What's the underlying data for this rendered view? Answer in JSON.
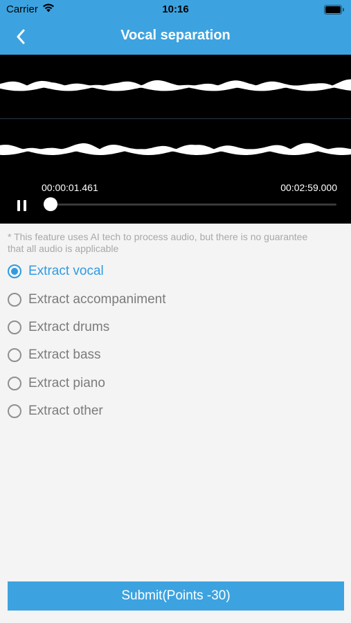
{
  "status_bar": {
    "carrier": "Carrier",
    "time": "10:16",
    "icons": [
      "wifi-icon",
      "battery-icon"
    ]
  },
  "nav": {
    "title": "Vocal separation",
    "back_icon": "chevron-left-icon"
  },
  "player": {
    "current_time": "00:00:01.461",
    "total_time": "00:02:59.000",
    "pause_icon": "pause-icon",
    "progress": 0.008
  },
  "notice": "* This feature uses AI tech to process audio, but there is no guarantee that all audio is applicable",
  "options": [
    {
      "label": "Extract vocal",
      "selected": true
    },
    {
      "label": "Extract accompaniment",
      "selected": false
    },
    {
      "label": "Extract drums",
      "selected": false
    },
    {
      "label": "Extract bass",
      "selected": false
    },
    {
      "label": "Extract piano",
      "selected": false
    },
    {
      "label": "Extract other",
      "selected": false
    }
  ],
  "submit_label": "Submit(Points -30)",
  "colors": {
    "accent": "#3ca3e0",
    "selected": "#2f9be0",
    "background": "#f4f4f4",
    "player_bg": "#000000"
  }
}
